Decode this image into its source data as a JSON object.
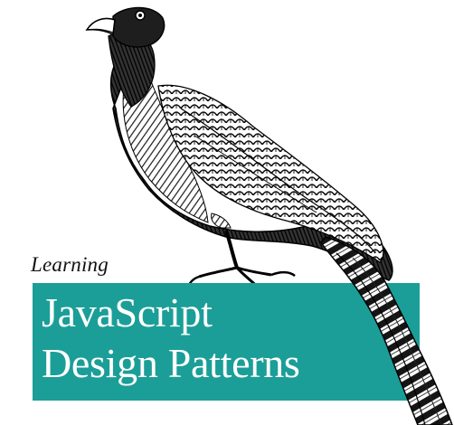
{
  "cover": {
    "series_label": "Learning",
    "title_line_1": "JavaScript",
    "title_line_2": "Design Patterns",
    "band_color": "#1b9e98",
    "illustration": "engraved-bird-illustration"
  }
}
